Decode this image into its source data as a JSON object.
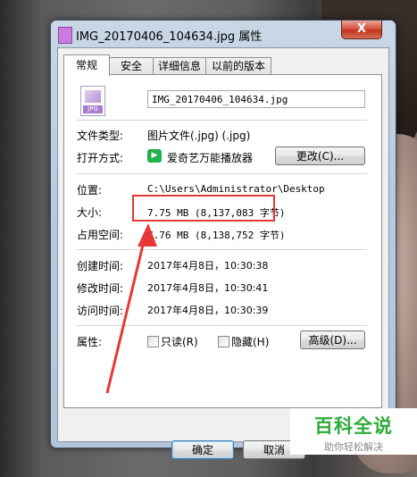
{
  "window": {
    "title": "IMG_20170406_104634.jpg 属性",
    "close_label": "X"
  },
  "tabs": [
    {
      "label": "常规",
      "active": true
    },
    {
      "label": "安全",
      "active": false
    },
    {
      "label": "详细信息",
      "active": false
    },
    {
      "label": "以前的版本",
      "active": false
    }
  ],
  "general": {
    "file_icon_tag": "JPG",
    "file_name": "IMG_20170406_104634.jpg",
    "file_type_label": "文件类型:",
    "file_type_value": "图片文件(.jpg) (.jpg)",
    "opens_with_label": "打开方式:",
    "opens_with_value": "爱奇艺万能播放器",
    "change_button": "更改(C)...",
    "location_label": "位置:",
    "location_value": "C:\\Users\\Administrator\\Desktop",
    "size_label": "大小:",
    "size_value": "7.75 MB (8,137,083 字节)",
    "size_on_disk_label": "占用空间:",
    "size_on_disk_value": "7.76 MB (8,138,752 字节)",
    "created_label": "创建时间:",
    "created_value": "2017年4月8日，10:30:38",
    "modified_label": "修改时间:",
    "modified_value": "2017年4月8日，10:30:41",
    "accessed_label": "访问时间:",
    "accessed_value": "2017年4月8日，10:30:39",
    "attributes_label": "属性:",
    "readonly_label": "只读(R)",
    "hidden_label": "隐藏(H)",
    "advanced_button": "高级(D)..."
  },
  "buttons": {
    "ok": "确定",
    "cancel": "取消"
  },
  "watermark": {
    "title": "百科全说",
    "subtitle": "助你轻松解决"
  },
  "colors": {
    "highlight": "#e53935",
    "watermark_green": "#2eaa3a"
  }
}
